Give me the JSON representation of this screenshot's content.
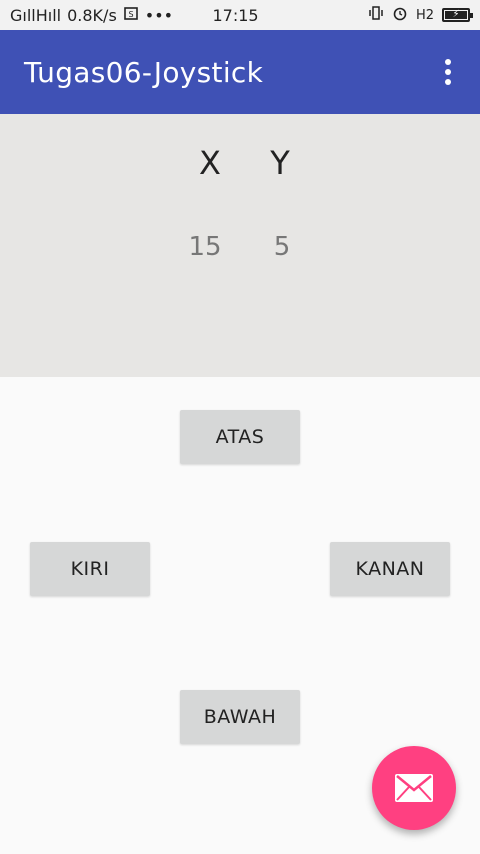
{
  "status_bar": {
    "signal_text": "GıllHıll",
    "speed": "0.8K/s",
    "dots": "•••",
    "time": "17:15",
    "network": "H2"
  },
  "app_bar": {
    "title": "Tugas06-Joystick"
  },
  "coordinates": {
    "x_label": "X",
    "y_label": "Y",
    "x_value": "15",
    "y_value": "5"
  },
  "buttons": {
    "up": "ATAS",
    "left": "KIRI",
    "right": "KANAN",
    "down": "BAWAH"
  },
  "colors": {
    "primary": "#3f51b5",
    "accent": "#ff4081",
    "panel": "#e7e6e4",
    "button": "#d6d7d7"
  }
}
